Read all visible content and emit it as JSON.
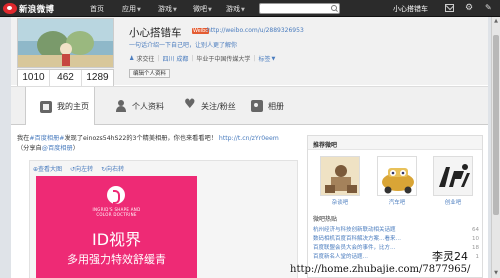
{
  "topbar": {
    "logo_text": "新浪微博",
    "nav": [
      {
        "label": "首页",
        "caret": false
      },
      {
        "label": "应用",
        "caret": true
      },
      {
        "label": "游戏",
        "caret": true
      },
      {
        "label": "微吧",
        "caret": true
      },
      {
        "label": "游戏",
        "caret": true
      }
    ],
    "user_name": "小心搭错车"
  },
  "profile": {
    "name": "小心搭错车",
    "badge": "Weibo",
    "url": "http://weibo.com/u/2889326953",
    "bio": "一句话介绍一下自己吧，让别人更了解你",
    "gender": "求交往",
    "location": "四川 成都",
    "school": "毕业于中国传媒大学",
    "tags": "标签",
    "edit_label": "编辑个人资料",
    "stats": [
      {
        "num": "1010",
        "label": "关注"
      },
      {
        "num": "462",
        "label": "粉丝"
      },
      {
        "num": "1289",
        "label": "微博"
      }
    ]
  },
  "tabs": [
    {
      "label": "我的主页",
      "icon": "home-icon"
    },
    {
      "label": "个人资料",
      "icon": "person-icon"
    },
    {
      "label": "关注/粉丝",
      "icon": "heart-icon"
    },
    {
      "label": "相册",
      "icon": "photo-icon"
    }
  ],
  "post": {
    "text_prefix": "我在",
    "text_link": "#百度相册#",
    "text_mid": "发现了einozs54hS22的3个精美相册，你也来看看吧！",
    "short_url": "http://t.cn/zYr0eem",
    "share_prefix": "（分享自",
    "share_link": "@百度相册",
    "share_suffix": "）",
    "actions": [
      "查看大图",
      "向左转",
      "向右转"
    ],
    "image_caption_1": "INGRID'S SHAPE AND",
    "image_caption_2": "COLOR DOCTRINE",
    "image_title": "ID视界",
    "image_subtitle": "多用强力特效舒缓青"
  },
  "sidebar": {
    "apps_title": "推荐微吧",
    "apps": [
      {
        "label": "杂谈吧"
      },
      {
        "label": "汽车吧"
      },
      {
        "label": "创业吧"
      }
    ],
    "hot_title": "微吧热贴",
    "hot": [
      {
        "title": "杭州经济与科技创新联动相关话题",
        "count": "64"
      },
      {
        "title": "数码相机百度百科解决方案…看来…",
        "count": "10"
      },
      {
        "title": "百度联盟会员大会的事件，比方…",
        "count": "18"
      },
      {
        "title": "百度新名人堂的话题…",
        "count": "1"
      }
    ]
  },
  "watermark": {
    "name": "李灵24",
    "url": "http://home.zhubajie.com/7877965/"
  }
}
